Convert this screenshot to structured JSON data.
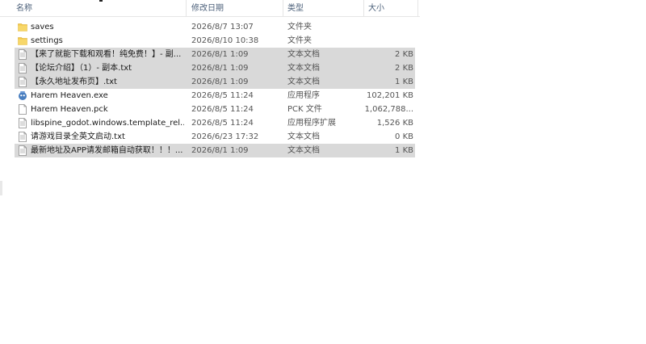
{
  "columns": {
    "name": "名称",
    "date": "修改日期",
    "type": "类型",
    "size": "大小"
  },
  "files": [
    {
      "name": "saves",
      "date": "2026/8/7 13:07",
      "type": "文件夹",
      "size": "",
      "icon": "folder-icon",
      "selected": false
    },
    {
      "name": "settings",
      "date": "2026/8/10 10:38",
      "type": "文件夹",
      "size": "",
      "icon": "folder-icon",
      "selected": false
    },
    {
      "name": "【来了就能下载和观看！纯免费！】- 副...",
      "date": "2026/8/1 1:09",
      "type": "文本文档",
      "size": "2 KB",
      "icon": "text-file-icon",
      "selected": true
    },
    {
      "name": "【论坛介绍】（1）- 副本.txt",
      "date": "2026/8/1 1:09",
      "type": "文本文档",
      "size": "2 KB",
      "icon": "text-file-icon",
      "selected": true
    },
    {
      "name": "【永久地址发布页】.txt",
      "date": "2026/8/1 1:09",
      "type": "文本文档",
      "size": "1 KB",
      "icon": "text-file-icon",
      "selected": true
    },
    {
      "name": "Harem Heaven.exe",
      "date": "2026/8/5 11:24",
      "type": "应用程序",
      "size": "102,201 KB",
      "icon": "app-exe-icon",
      "selected": false
    },
    {
      "name": "Harem Heaven.pck",
      "date": "2026/8/5 11:24",
      "type": "PCK 文件",
      "size": "1,062,788...",
      "icon": "blank-file-icon",
      "selected": false
    },
    {
      "name": "libspine_godot.windows.template_rel...",
      "date": "2026/8/5 11:24",
      "type": "应用程序扩展",
      "size": "1,526 KB",
      "icon": "dll-file-icon",
      "selected": false
    },
    {
      "name": "请游戏目录全英文启动.txt",
      "date": "2026/6/23 17:32",
      "type": "文本文档",
      "size": "0 KB",
      "icon": "text-file-icon",
      "selected": false
    },
    {
      "name": "最新地址及APP请发邮箱自动获取！！！...",
      "date": "2026/8/1 1:09",
      "type": "文本文档",
      "size": "1 KB",
      "icon": "text-file-icon",
      "selected": true
    }
  ],
  "colors": {
    "folder": "#f3c94b",
    "selection": "#d9d9d9",
    "header_text": "#4c607a"
  }
}
